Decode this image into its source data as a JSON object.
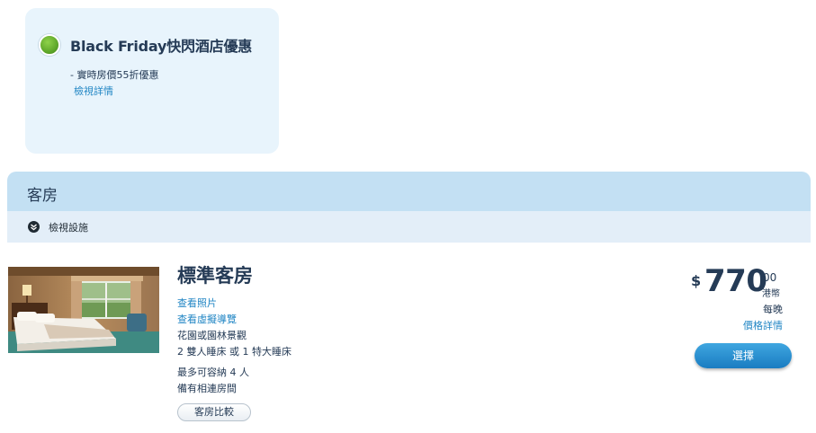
{
  "promo": {
    "title": "Black Friday快閃酒店優惠",
    "detail_line": "- 實時房價55折優惠",
    "details_link": "檢視詳情",
    "icon": "green-dot-icon"
  },
  "rooms_section": {
    "title": "客房",
    "amenities_toggle": "檢視設施",
    "toggle_icon": "chevron-down-icon"
  },
  "room": {
    "name": "標準客房",
    "view_photos_link": "查看照片",
    "virtual_tour_link": "查看虛擬導覽",
    "view_type": "花園或園林景觀",
    "bed_config": "2 雙人睡床 或 1 特大睡床",
    "max_occupancy": "最多可容納 4 人",
    "connecting_rooms": "備有相連房間",
    "compare_button": "客房比較",
    "price": {
      "currency_symbol": "$",
      "amount": "770",
      "cents": "00",
      "currency": "港幣",
      "per_night": "每晚",
      "price_details_link": "價格詳情"
    },
    "select_button": "選擇"
  },
  "colors": {
    "accent_link": "#2186c4",
    "text_dark": "#253b56",
    "promo_bg": "#e8f4fc",
    "header_bg": "#c3e0f3",
    "button_blue": "#1a7cc1"
  }
}
